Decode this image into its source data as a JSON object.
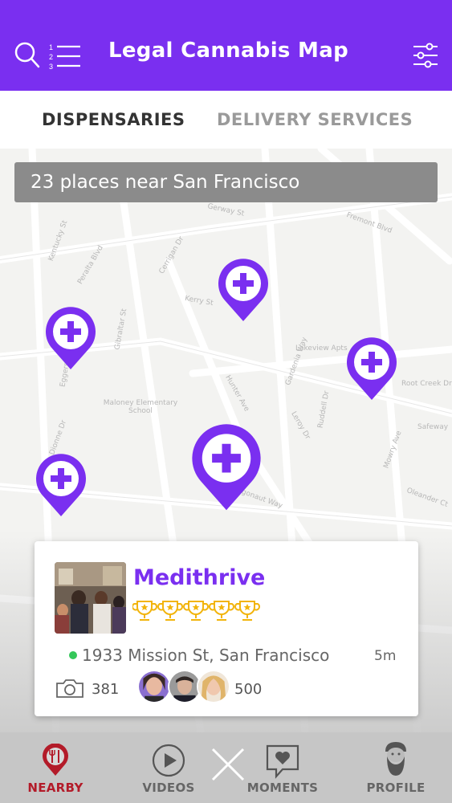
{
  "header": {
    "title": "Legal Cannabis Map",
    "background": "#7a2ff0",
    "icons": [
      "search-icon",
      "ranked-list-icon",
      "filter-sliders-icon"
    ]
  },
  "tabs": [
    {
      "label": "DISPENSARIES",
      "active": true
    },
    {
      "label": "DELIVERY SERVICES",
      "active": false
    }
  ],
  "map": {
    "banner_text": "23 places near San Francisco",
    "streets": [
      "Fremont Blvd",
      "Gerway St",
      "Cerrigan Dr",
      "Eggers Dr",
      "Kentucky St",
      "Peralta Blvd",
      "Lakeview Apts",
      "Root Creek Dr",
      "Safeway",
      "Maloney Elementary School",
      "Dionne Dr",
      "Mowry Ave",
      "Gardenia Way",
      "Hunter Ave",
      "Argonaut Way",
      "Kerry St",
      "Gibraltar St",
      "Ruddell Dr",
      "Leroy Dr",
      "Oleander Ct"
    ],
    "pin_icon": "dispensary-plus-pin-icon",
    "pin_color": "#7a2ff0"
  },
  "card": {
    "name": "Medithrive",
    "trophies": 5,
    "trophy_color": "#f2b40c",
    "address": "1933 Mission St, San Francisco",
    "time": "5m",
    "photo_count": "381",
    "followers": "500",
    "status_color": "#34c759"
  },
  "nav": [
    {
      "label": "NEARBY",
      "icon": "fork-knife-pin-icon",
      "active": true
    },
    {
      "label": "VIDEOS",
      "icon": "play-circle-icon",
      "active": false
    },
    {
      "label": "",
      "icon": "close-icon",
      "active": false
    },
    {
      "label": "MOMENTS",
      "icon": "heart-message-icon",
      "active": false
    },
    {
      "label": "PROFILE",
      "icon": "bearded-man-icon",
      "active": false
    }
  ]
}
